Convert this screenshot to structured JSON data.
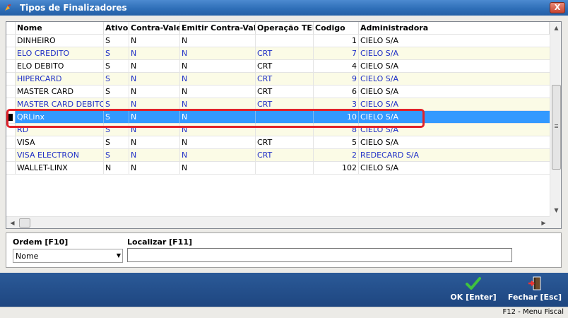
{
  "window": {
    "title": "Tipos de Finalizadores",
    "close_label": "X"
  },
  "grid": {
    "columns": [
      "Nome",
      "Ativo",
      "Contra-Vale",
      "Emitir Contra-Vale",
      "Operação TEF",
      "Codigo",
      "Administradora"
    ],
    "rows": [
      [
        "DINHEIRO",
        "S",
        "N",
        "N",
        "",
        "1",
        "CIELO S/A"
      ],
      [
        "ELO CREDITO",
        "S",
        "N",
        "N",
        "CRT",
        "7",
        "CIELO S/A"
      ],
      [
        "ELO DEBITO",
        "S",
        "N",
        "N",
        "CRT",
        "4",
        "CIELO S/A"
      ],
      [
        "HIPERCARD",
        "S",
        "N",
        "N",
        "CRT",
        "9",
        "CIELO S/A"
      ],
      [
        "MASTER CARD",
        "S",
        "N",
        "N",
        "CRT",
        "6",
        "CIELO S/A"
      ],
      [
        "MASTER CARD DEBITO",
        "S",
        "N",
        "N",
        "CRT",
        "3",
        "CIELO S/A"
      ],
      [
        "QRLinx",
        "S",
        "N",
        "N",
        "",
        "10",
        "CIELO S/A"
      ],
      [
        "RD",
        "S",
        "N",
        "N",
        "",
        "8",
        "CIELO S/A"
      ],
      [
        "VISA",
        "S",
        "N",
        "N",
        "CRT",
        "5",
        "CIELO S/A"
      ],
      [
        "VISA ELECTRON",
        "S",
        "N",
        "N",
        "CRT",
        "2",
        "REDECARD S/A"
      ],
      [
        "WALLET-LINX",
        "N",
        "N",
        "N",
        "",
        "102",
        "CIELO S/A"
      ]
    ],
    "selected_row": "QRLinx"
  },
  "filters": {
    "order_label": "Ordem [F10]",
    "order_value": "Nome",
    "search_label": "Localizar [F11]",
    "search_value": ""
  },
  "footer": {
    "ok_label": "OK [Enter]",
    "exit_label": "Fechar [Esc]"
  },
  "status": {
    "text": "F12 - Menu Fiscal"
  },
  "colors": {
    "titlebar": "#2f6fb8",
    "selection": "#3399ff",
    "highlight": "#e2222a",
    "footer": "#1e4680",
    "blue_text": "#1f2fc7",
    "alt_row": "#fbfbe6"
  },
  "icons": {
    "title": "app-icon",
    "ok": "checkmark-icon",
    "exit": "exit-door-icon"
  }
}
